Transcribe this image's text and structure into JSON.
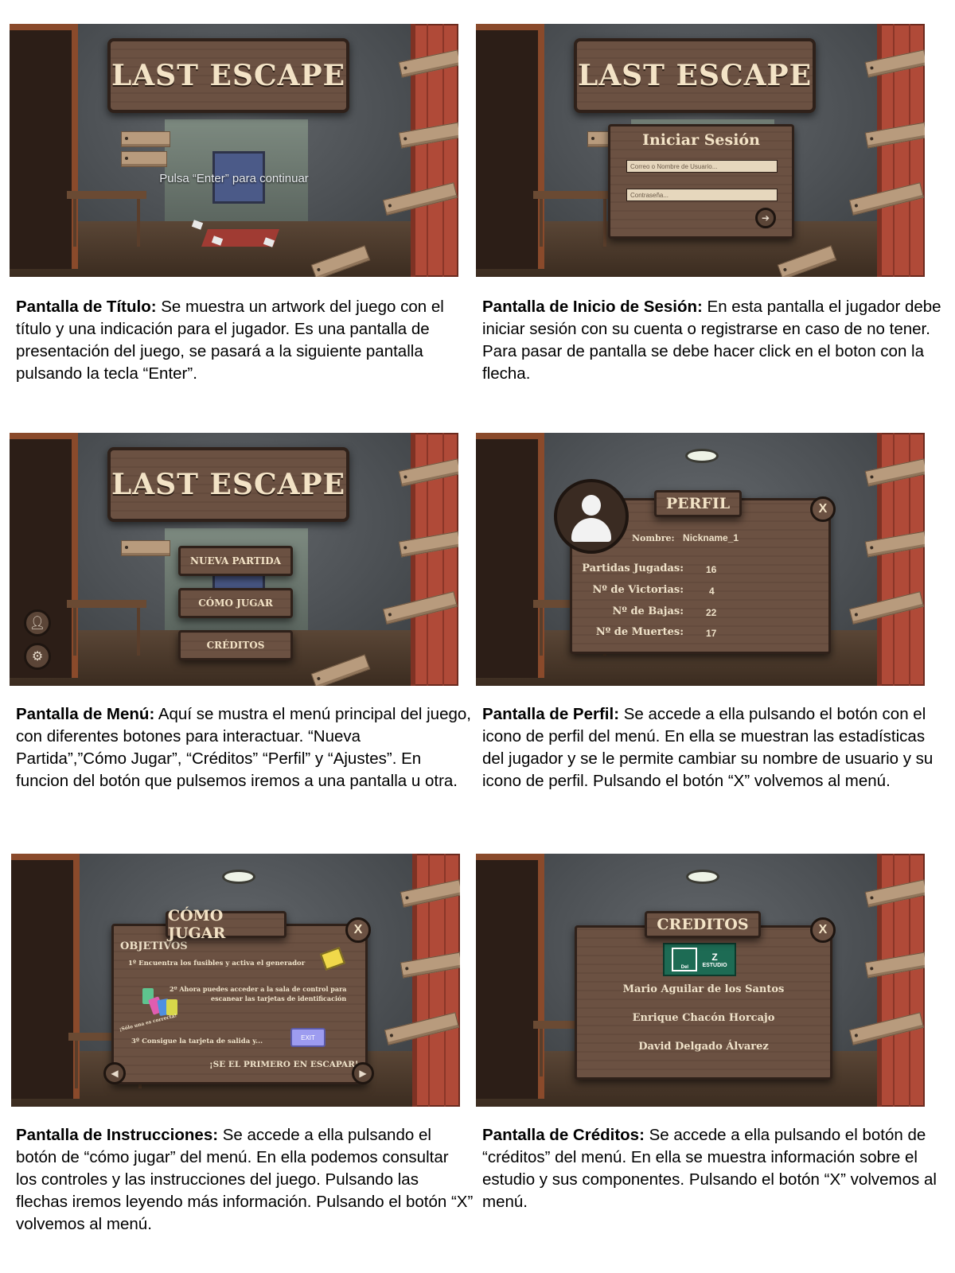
{
  "game_title": "LAST ESCAPE",
  "title_screen": {
    "hint": "Pulsa “Enter” para continuar"
  },
  "login_screen": {
    "title": "Iniciar Sesión",
    "username_placeholder": "Correo o Nombre de Usuario...",
    "password_placeholder": "Contraseña...",
    "submit_icon": "arrow-right-icon"
  },
  "menu_screen": {
    "buttons": [
      "NUEVA PARTIDA",
      "CÓMO JUGAR",
      "CRÉDITOS"
    ],
    "profile_icon": "user-icon",
    "settings_icon": "gear-icon"
  },
  "profile_screen": {
    "title": "PERFIL",
    "name_label": "Nombre:",
    "name_value": "Nickname_1",
    "stats": [
      {
        "label": "Partidas Jugadas:",
        "value": "16"
      },
      {
        "label": "Nº de Victorias:",
        "value": "4"
      },
      {
        "label": "Nº de Bajas:",
        "value": "22"
      },
      {
        "label": "Nº de Muertes:",
        "value": "17"
      }
    ],
    "close": "X"
  },
  "howto_screen": {
    "title": "CÓMO JUGAR",
    "section": "OBJETIVOS",
    "step1": "1º Encuentra los fusibles y activa el generador",
    "step2_line1": "2º Ahora puedes acceder a la sala de control para",
    "step2_line2": "escanear las tarjetas de identificación",
    "note": "¡Sólo una es correcta!",
    "step3": "3º Consigue la tarjeta de salida y...",
    "exit_card": "EXIT",
    "final": "¡SE EL PRIMERO EN ESCAPAR!",
    "close": "X"
  },
  "credits_screen": {
    "title": "CREDITOS",
    "studio_label": "ESTUDIO",
    "studio_keys": [
      "Del",
      "Z"
    ],
    "members": [
      "Mario Aguilar de los Santos",
      "Enrique Chacón Horcajo",
      "David Delgado Álvarez"
    ],
    "close": "X"
  },
  "captions": [
    {
      "bold": "Pantalla de Título:",
      "text": " Se muestra un artwork del juego con el título y una indicación para el jugador. Es una pantalla de presentación del juego, se pasará a la siguiente pantalla pulsando la tecla “Enter”."
    },
    {
      "bold": "Pantalla de Inicio de Sesión:",
      "text": " En esta pantalla el jugador debe iniciar sesión con su cuenta o registrarse en caso de no tener. Para pasar de pantalla se debe hacer click en el boton con la flecha."
    },
    {
      "bold": "Pantalla de Menú:",
      "text": " Aquí se mustra el menú principal del juego, con diferentes botones para interactuar. “Nueva Partida”,”Cómo Jugar”, “Créditos” “Perfil” y “Ajustes”. En funcion del botón que pulsemos iremos a una pantalla u otra."
    },
    {
      "bold": "Pantalla de Perfil:",
      "text": " Se accede a ella pulsando el botón con el icono de perfil del menú. En ella se muestran las estadísticas del jugador y se le permite cambiar su nombre de usuario y su icono de perfil. Pulsando el botón “X” volvemos al menú."
    },
    {
      "bold": "Pantalla de Instrucciones:",
      "text": " Se accede a ella pulsando el botón de “cómo jugar” del menú. En ella podemos consultar los controles y las instrucciones del juego. Pulsando las flechas iremos leyendo más información. Pulsando el botón “X” volvemos al menú."
    },
    {
      "bold": "Pantalla de Créditos:",
      "text": " Se accede a ella pulsando el botón de “créditos” del menú. En ella se muestra información sobre el estudio y sus componentes. Pulsando el botón “X” volvemos al menú."
    }
  ]
}
